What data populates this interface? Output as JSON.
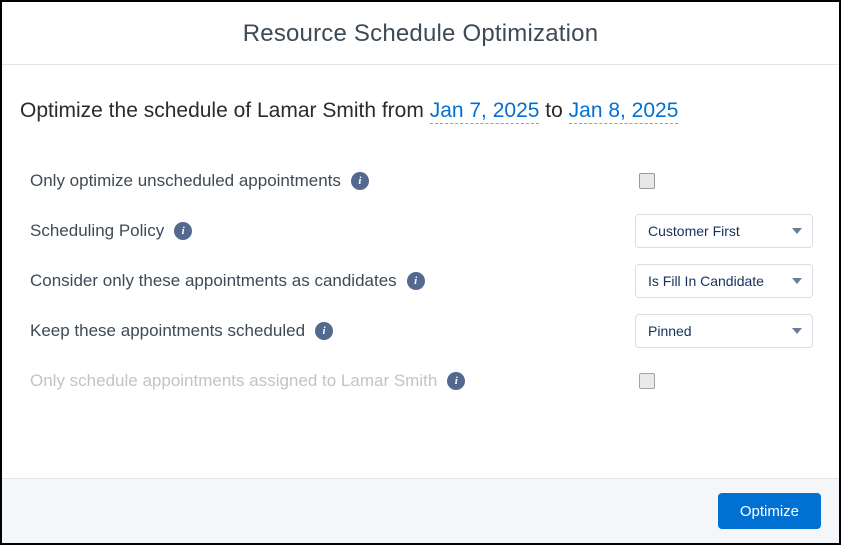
{
  "dialog": {
    "title": "Resource Schedule Optimization"
  },
  "summary": {
    "prefix": "Optimize the schedule of ",
    "resource_name": "Lamar Smith",
    "mid1": " from ",
    "start_date": "Jan 7, 2025",
    "mid2": " to ",
    "end_date": "Jan 8, 2025"
  },
  "rows": {
    "only_unscheduled": {
      "label": "Only optimize unscheduled appointments",
      "checked": false
    },
    "scheduling_policy": {
      "label": "Scheduling Policy",
      "selected": "Customer First"
    },
    "candidates": {
      "label": "Consider only these appointments as candidates",
      "selected": "Is Fill In Candidate"
    },
    "keep_scheduled": {
      "label": "Keep these appointments scheduled",
      "selected": "Pinned"
    },
    "only_assigned": {
      "label": "Only schedule appointments assigned to Lamar Smith",
      "checked": false,
      "disabled": true
    }
  },
  "footer": {
    "optimize_label": "Optimize"
  },
  "glyphs": {
    "info": "i"
  }
}
